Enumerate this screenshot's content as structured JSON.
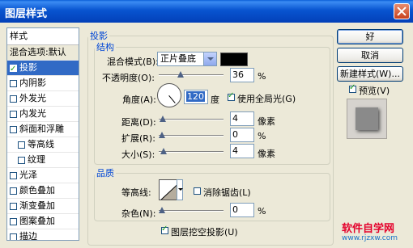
{
  "window": {
    "title": "图层样式"
  },
  "style_list": {
    "header": "样式",
    "items": [
      {
        "label": "混合选项:默认",
        "checkbox": false,
        "checked": false,
        "selected": false,
        "indent": false
      },
      {
        "label": "投影",
        "checkbox": true,
        "checked": true,
        "selected": true,
        "indent": false
      },
      {
        "label": "内阴影",
        "checkbox": true,
        "checked": false,
        "selected": false,
        "indent": false
      },
      {
        "label": "外发光",
        "checkbox": true,
        "checked": false,
        "selected": false,
        "indent": false
      },
      {
        "label": "内发光",
        "checkbox": true,
        "checked": false,
        "selected": false,
        "indent": false
      },
      {
        "label": "斜面和浮雕",
        "checkbox": true,
        "checked": false,
        "selected": false,
        "indent": false
      },
      {
        "label": "等高线",
        "checkbox": true,
        "checked": false,
        "selected": false,
        "indent": true
      },
      {
        "label": "纹理",
        "checkbox": true,
        "checked": false,
        "selected": false,
        "indent": true
      },
      {
        "label": "光泽",
        "checkbox": true,
        "checked": false,
        "selected": false,
        "indent": false
      },
      {
        "label": "颜色叠加",
        "checkbox": true,
        "checked": false,
        "selected": false,
        "indent": false
      },
      {
        "label": "渐变叠加",
        "checkbox": true,
        "checked": false,
        "selected": false,
        "indent": false
      },
      {
        "label": "图案叠加",
        "checkbox": true,
        "checked": false,
        "selected": false,
        "indent": false
      },
      {
        "label": "描边",
        "checkbox": true,
        "checked": false,
        "selected": false,
        "indent": false
      }
    ]
  },
  "drop_shadow": {
    "title": "投影",
    "structure": {
      "title": "结构",
      "blend_mode_label": "混合模式(B):",
      "blend_mode_value": "正片叠底",
      "shadow_color": "#000000",
      "opacity_label": "不透明度(O):",
      "opacity_value": "36",
      "opacity_unit": "%",
      "angle_label": "角度(A):",
      "angle_value": "120",
      "angle_unit": "度",
      "global_light_label": "使用全局光(G)",
      "global_light_checked": true,
      "distance_label": "距离(D):",
      "distance_value": "4",
      "distance_unit": "像素",
      "spread_label": "扩展(R):",
      "spread_value": "0",
      "spread_unit": "%",
      "size_label": "大小(S):",
      "size_value": "4",
      "size_unit": "像素"
    },
    "quality": {
      "title": "品质",
      "contour_label": "等高线:",
      "anti_alias_label": "消除锯齿(L)",
      "anti_alias_checked": false,
      "noise_label": "杂色(N):",
      "noise_value": "0",
      "noise_unit": "%"
    },
    "knockout_label": "图层挖空投影(U)",
    "knockout_checked": true
  },
  "buttons": {
    "ok": "好",
    "cancel": "取消",
    "new_style": "新建样式(W)...",
    "preview_label": "预览(V)",
    "preview_checked": true
  },
  "watermark": {
    "line1": "软件自学网",
    "line2": "www.rjzxw.com"
  },
  "colors": {
    "titlebar": "#0a5fd8",
    "selection": "#316ac5",
    "group_title": "#0046d5"
  }
}
